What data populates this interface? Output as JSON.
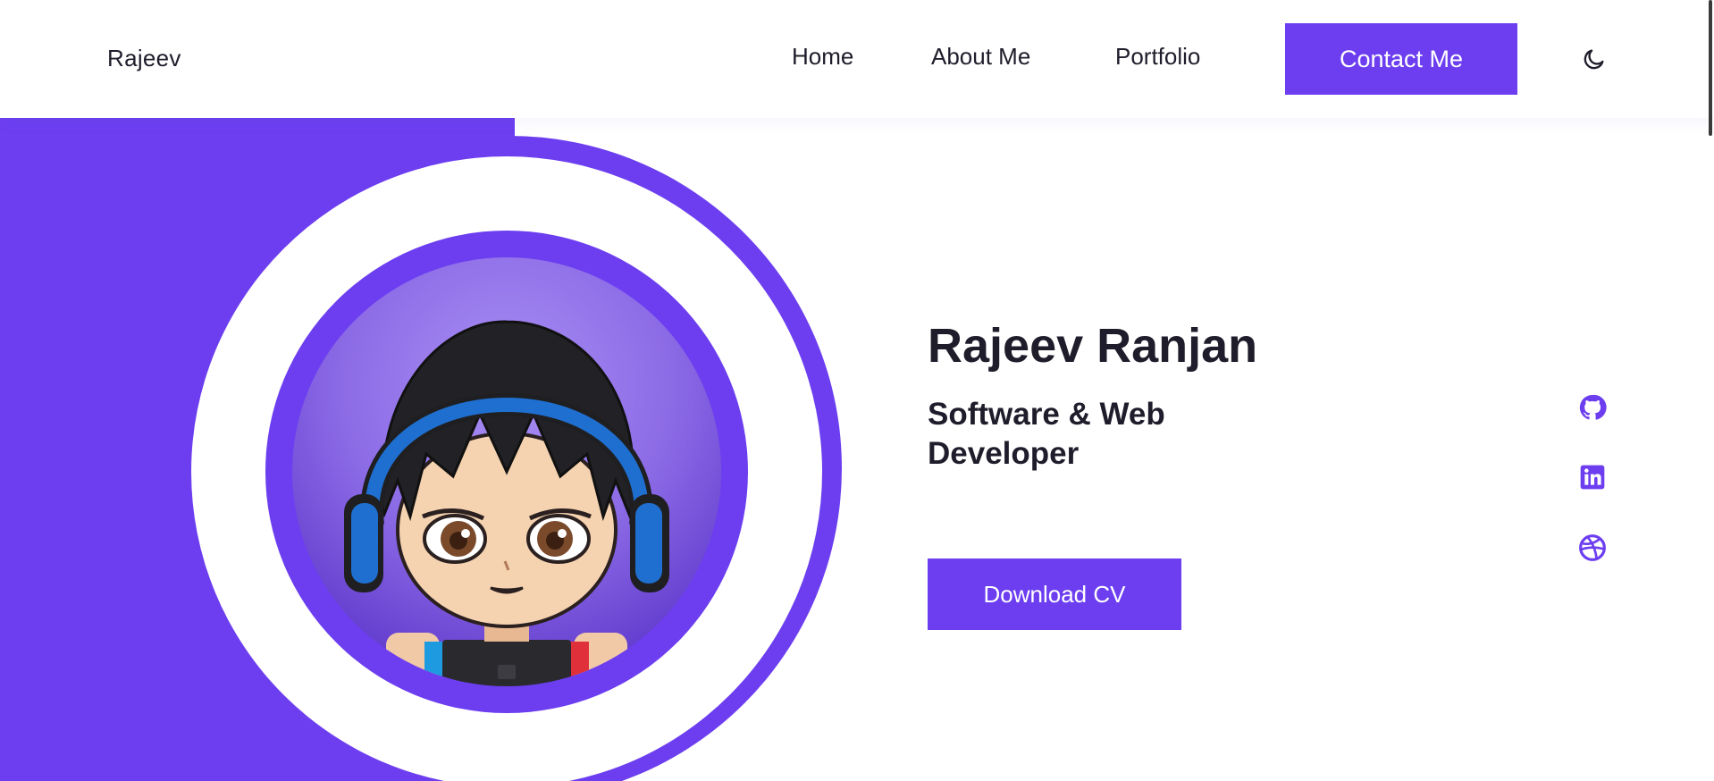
{
  "header": {
    "logo": "Rajeev",
    "nav": {
      "home": "Home",
      "about": "About Me",
      "portfolio": "Portfolio",
      "contact": "Contact Me"
    },
    "theme_icon": "moon-icon"
  },
  "hero": {
    "name": "Rajeev Ranjan",
    "role": "Software & Web Developer",
    "download_label": "Download CV",
    "avatar": "cartoon-avatar-with-headphones"
  },
  "social": [
    {
      "icon": "github-icon"
    },
    {
      "icon": "linkedin-icon"
    },
    {
      "icon": "dribbble-icon"
    }
  ],
  "colors": {
    "accent": "#6c3ef0",
    "text": "#1f1d2b",
    "background": "#ffffff"
  }
}
